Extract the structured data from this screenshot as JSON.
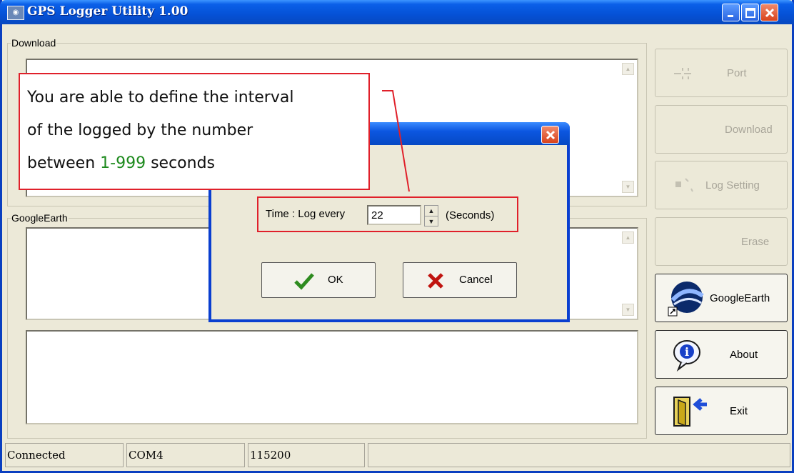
{
  "window": {
    "title": "GPS Logger Utility 1.00",
    "app_icon": "gps-app-icon",
    "controls": [
      "minimize-icon",
      "maximize-icon",
      "close-icon"
    ]
  },
  "groups": {
    "download_label": "Download",
    "googleearth_label": "GoogleEarth"
  },
  "side_buttons": {
    "port": {
      "label": "Port",
      "icon": "port-icon",
      "enabled": false
    },
    "download": {
      "label": "Download",
      "enabled": false
    },
    "log_setting": {
      "label": "Log Setting",
      "icon": "log-setting-icon",
      "enabled": false
    },
    "erase": {
      "label": "Erase",
      "enabled": false
    },
    "googleearth": {
      "label": "GoogleEarth",
      "icon": "google-earth-icon",
      "enabled": true
    },
    "about": {
      "label": "About",
      "icon": "info-icon",
      "enabled": true
    },
    "exit": {
      "label": "Exit",
      "icon": "exit-door-icon",
      "enabled": true
    }
  },
  "statusbar": {
    "status": "Connected",
    "port": "COM4",
    "baud": "115200",
    "extra": ""
  },
  "dialog": {
    "time_label": "Time : Log every",
    "interval_value": "22",
    "unit_label": "(Seconds)",
    "ok_label": "OK",
    "cancel_label": "Cancel"
  },
  "callout": {
    "line1": "You are able to define the interval",
    "line2": "of the logged by the number",
    "line3_prefix": "between ",
    "line3_range": "1-999",
    "line3_suffix": " seconds"
  },
  "colors": {
    "titlebar": "#0551d6",
    "highlight": "#e0202a",
    "range_text": "#1d8a1d",
    "window_bg": "#ece9d8"
  }
}
